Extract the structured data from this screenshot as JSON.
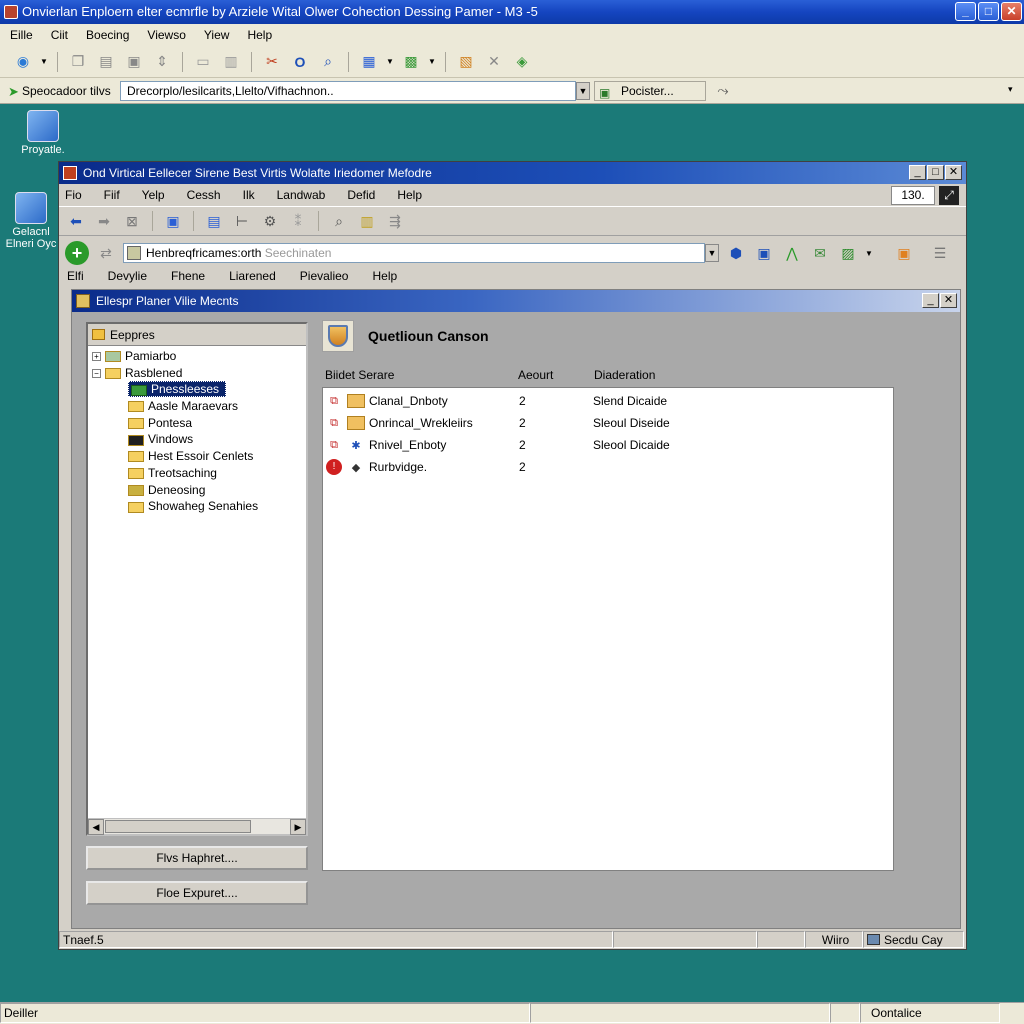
{
  "outer": {
    "title": "Onvierlan Enploern elter ecmrfle by Arziele Wital Olwer Cohection Dessing Pamer - M3 -5",
    "menu": [
      "Eille",
      "Ciit",
      "Boecing",
      "Viewso",
      "Yiew",
      "Help"
    ],
    "address_label": "Speocadoor tilvs",
    "address_value": "Drecorplo/lesilcarits,Llelto/Vifhachnon..",
    "go_label": "Pocister...",
    "status_left": "Deiller",
    "status_right": "Oontalice"
  },
  "desktop": {
    "icons": [
      {
        "label": "Proyatle."
      },
      {
        "label": "Gelacnl Elneri Oyc"
      }
    ]
  },
  "inner": {
    "title": "Ond Virtical Eellecer Sirene Best Virtis Wolafte Iriedomer Mefodre",
    "menu": [
      "Fio",
      "Fiif",
      "Yelp",
      "Cessh",
      "Ilk",
      "Landwab",
      "Defid",
      "Help"
    ],
    "zoom": "130.",
    "address_value": "Henbreqfricames:orth",
    "address_placeholder": "Seechinaten",
    "menu2": [
      "Elfi",
      "Devylie",
      "Fhene",
      "Liarened",
      "Pievalieo",
      "Help"
    ],
    "status": {
      "left": "Tnaef.5",
      "mid": "Wiiro",
      "right": "Secdu Cay"
    }
  },
  "child": {
    "title": "Ellespr Planer Vilie Mecnts",
    "tree_header": "Eeppres",
    "tree": [
      {
        "label": "Pamiarbo",
        "expander": "⊞"
      },
      {
        "label": "Rasblened",
        "expander": "⊟"
      },
      {
        "label": "Pnessleeses",
        "expander": "",
        "selected": true
      },
      {
        "label": "Aasle Maraevars",
        "expander": ""
      },
      {
        "label": "Pontesa",
        "expander": ""
      },
      {
        "label": "Vindows",
        "expander": ""
      },
      {
        "label": "Hest Essoir Cenlets",
        "expander": ""
      },
      {
        "label": "Treotsaching",
        "expander": ""
      },
      {
        "label": "Deneosing",
        "expander": ""
      },
      {
        "label": "Showaheg Senahies",
        "expander": ""
      }
    ],
    "button1": "Flvs Haphret....",
    "button2": "Floe Expuret....",
    "header_title": "Quetlioun Canson",
    "columns": [
      "Biidet Serare",
      "Aeourt",
      "Diaderation"
    ],
    "rows": [
      {
        "name": "Clanal_Dnboty",
        "count": "2",
        "desc": "Slend Dicaide"
      },
      {
        "name": "Onrincal_Wrekleiirs",
        "count": "2",
        "desc": "Sleoul Diseide"
      },
      {
        "name": "Rnivel_Enboty",
        "count": "2",
        "desc": "Sleool Dicaide"
      },
      {
        "name": "Rurbvidge.",
        "count": "2",
        "desc": ""
      }
    ]
  }
}
